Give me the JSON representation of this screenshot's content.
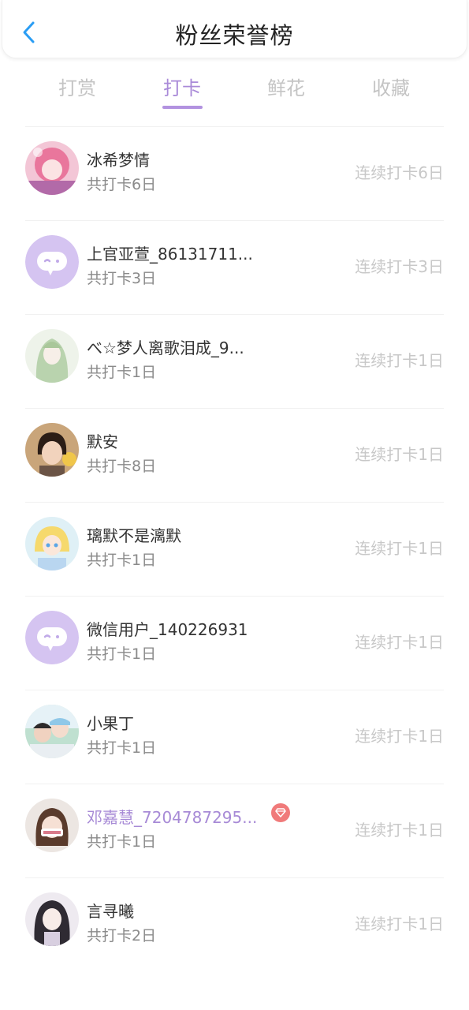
{
  "header": {
    "title": "粉丝荣誉榜"
  },
  "tabs": [
    {
      "label": "打赏",
      "active": false
    },
    {
      "label": "打卡",
      "active": true
    },
    {
      "label": "鲜花",
      "active": false
    },
    {
      "label": "收藏",
      "active": false
    }
  ],
  "colors": {
    "accent": "#a98ad8",
    "placeholder_avatar": "#d5c4f1",
    "vip_badge": "#f07a7a"
  },
  "entries": [
    {
      "name": "冰希梦情",
      "total": "共打卡6日",
      "streak": "连续打卡6日",
      "avatar": "photo-avatar",
      "vip": false
    },
    {
      "name": "上官亚萱_86131711...",
      "total": "共打卡3日",
      "streak": "连续打卡3日",
      "avatar": "chat-bubble-icon",
      "vip": false
    },
    {
      "name": "べ☆梦人离歌泪成_9...",
      "total": "共打卡1日",
      "streak": "连续打卡1日",
      "avatar": "photo-avatar",
      "vip": false
    },
    {
      "name": "默安",
      "total": "共打卡8日",
      "streak": "连续打卡1日",
      "avatar": "photo-avatar",
      "vip": false
    },
    {
      "name": "璃默不是漓默",
      "total": "共打卡1日",
      "streak": "连续打卡1日",
      "avatar": "photo-avatar",
      "vip": false
    },
    {
      "name": "微信用户_140226931",
      "total": "共打卡1日",
      "streak": "连续打卡1日",
      "avatar": "chat-bubble-icon",
      "vip": false
    },
    {
      "name": "小果丁",
      "total": "共打卡1日",
      "streak": "连续打卡1日",
      "avatar": "photo-avatar",
      "vip": false
    },
    {
      "name": "邓嘉慧_7204787295...",
      "total": "共打卡1日",
      "streak": "连续打卡1日",
      "avatar": "photo-avatar",
      "vip": true,
      "badge_icon": "diamond-icon"
    },
    {
      "name": "言寻曦",
      "total": "共打卡2日",
      "streak": "连续打卡1日",
      "avatar": "photo-avatar",
      "vip": false
    }
  ]
}
